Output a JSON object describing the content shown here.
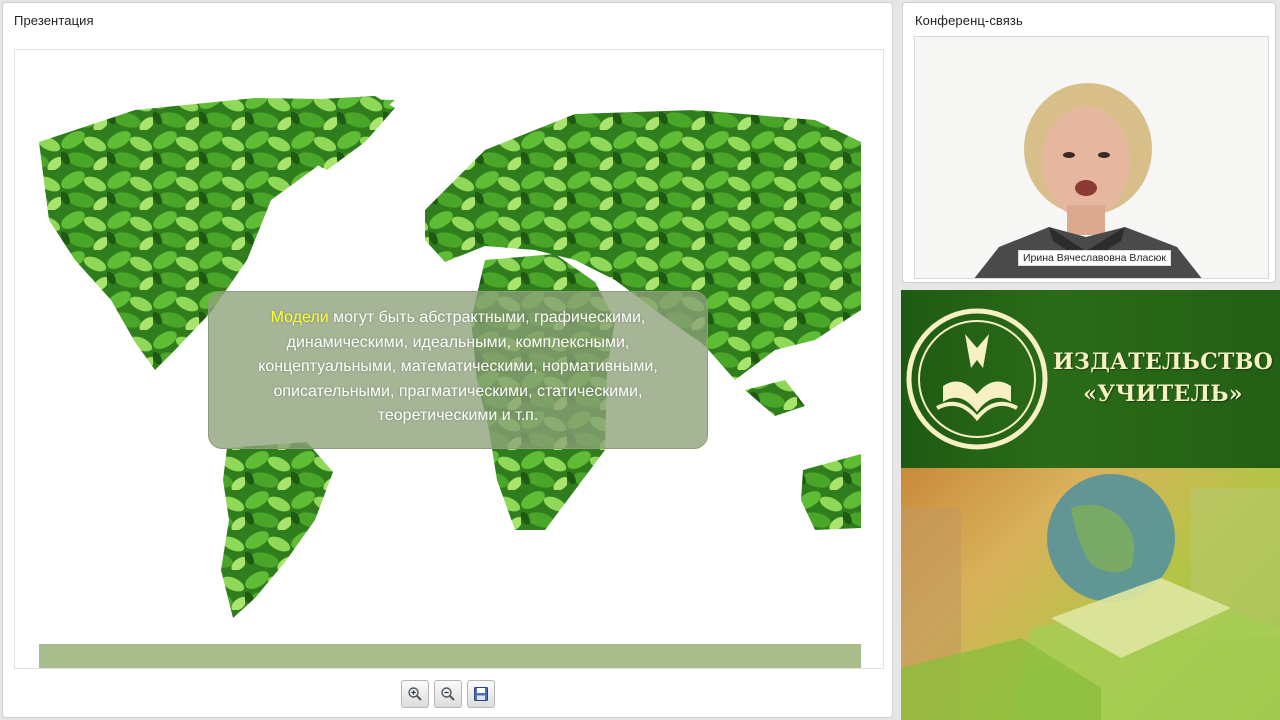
{
  "presentation": {
    "title": "Презентация",
    "slide": {
      "highlight_word": "Модели",
      "body_text": " могут быть абстрактными, графическими, динамическими, идеальными, комплексными, концептуальными, математическими, нормативными, описательными, прагматическими, статическими, теоретическими и т.п.",
      "accent_color": "#ffff33"
    },
    "toolbar": {
      "zoom_in_icon": "zoom-in-icon",
      "zoom_out_icon": "zoom-out-icon",
      "save_icon": "floppy-disk-icon"
    }
  },
  "conference": {
    "title": "Конференц-связь",
    "participant_name": "Ирина Вячеславовна Власюк"
  },
  "ad": {
    "publisher_line1": "ИЗДАТЕЛЬСТВО",
    "publisher_line2": "«УЧИТЕЛЬ»",
    "brand_green": "#2a6b18",
    "brand_cream": "#f6f0c4"
  }
}
